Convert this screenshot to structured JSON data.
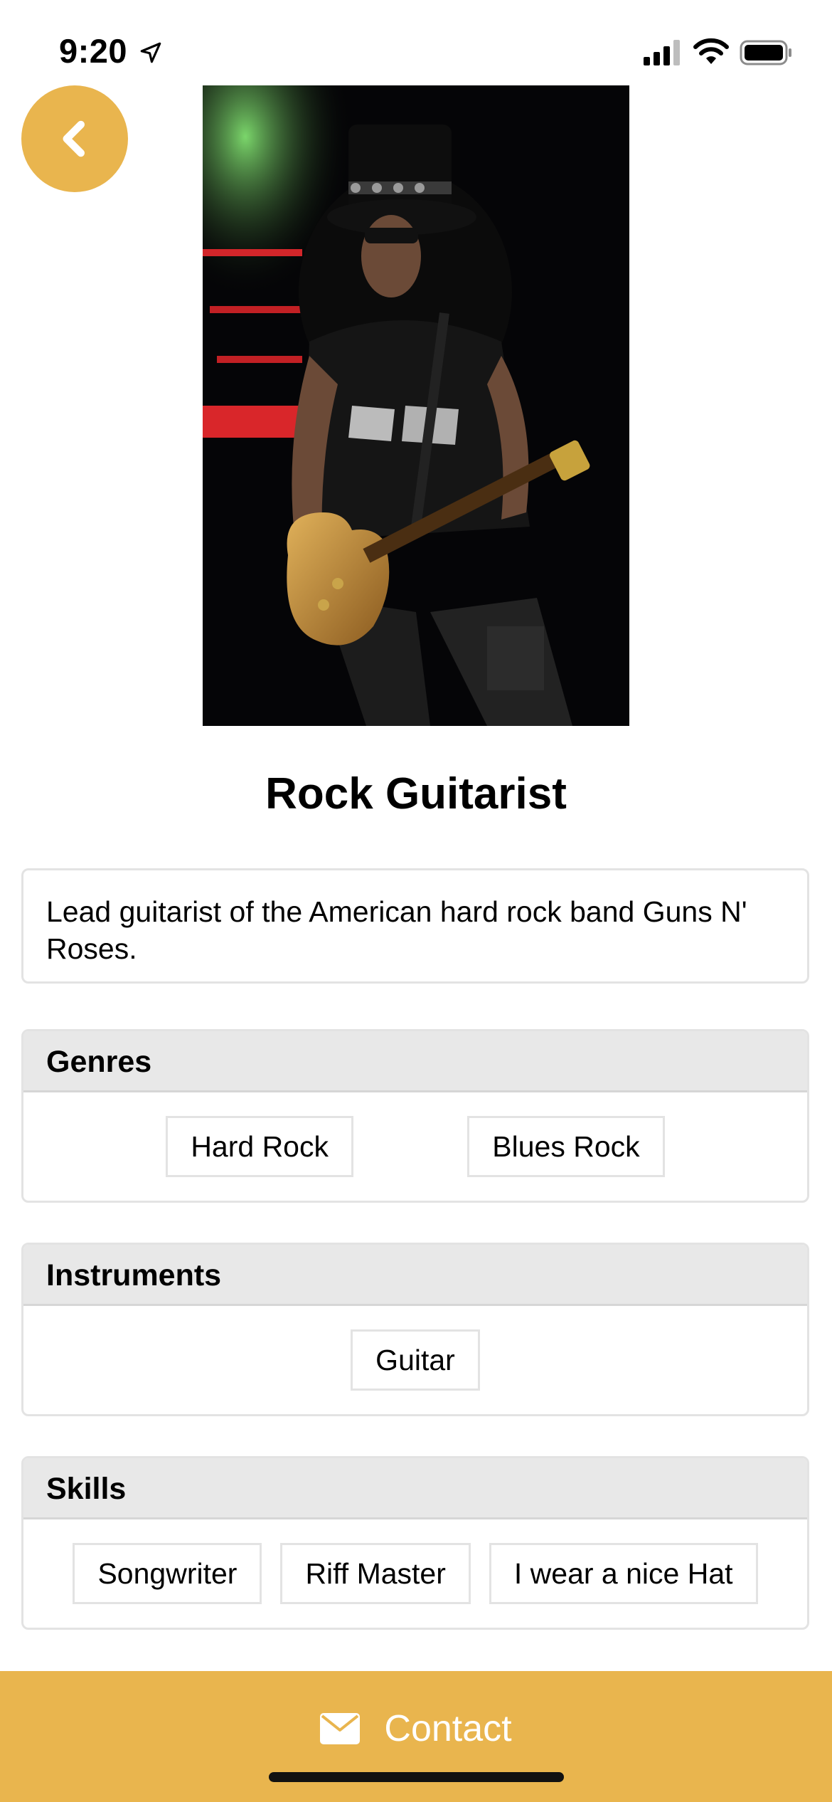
{
  "status_bar": {
    "time": "9:20"
  },
  "profile": {
    "title": "Rock Guitarist",
    "description": "Lead guitarist of the American hard rock band Guns N' Roses."
  },
  "sections": {
    "genres": {
      "header": "Genres",
      "tags": [
        "Hard Rock",
        "Blues Rock"
      ]
    },
    "instruments": {
      "header": "Instruments",
      "tags": [
        "Guitar"
      ]
    },
    "skills": {
      "header": "Skills",
      "tags": [
        "Songwriter",
        "Riff Master",
        "I wear a nice Hat"
      ]
    }
  },
  "contact": {
    "label": "Contact"
  },
  "icons": {
    "back": "chevron-left-icon",
    "mail": "mail-icon",
    "location": "location-arrow-icon",
    "signal": "cellular-signal-icon",
    "wifi": "wifi-icon",
    "battery": "battery-icon"
  },
  "colors": {
    "accent": "#E9B54E",
    "card_border": "#e3e3e3",
    "header_bg": "#e8e8e8"
  }
}
